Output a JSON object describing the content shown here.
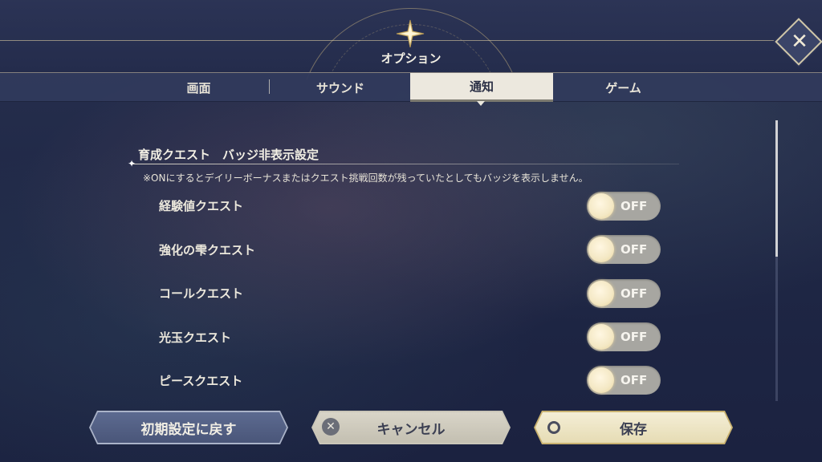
{
  "header": {
    "title": "オプション",
    "close_icon": "close-icon"
  },
  "tabs": [
    {
      "label": "画面",
      "active": false
    },
    {
      "label": "サウンド",
      "active": false
    },
    {
      "label": "通知",
      "active": true
    },
    {
      "label": "ゲーム",
      "active": false
    }
  ],
  "section": {
    "title": "育成クエスト　バッジ非表示設定",
    "note": "※ONにするとデイリーボーナスまたはクエスト挑戦回数が残っていたとしてもバッジを表示しません。"
  },
  "rows": [
    {
      "label": "経験値クエスト",
      "toggle": "OFF"
    },
    {
      "label": "強化の雫クエスト",
      "toggle": "OFF"
    },
    {
      "label": "コールクエスト",
      "toggle": "OFF"
    },
    {
      "label": "光玉クエスト",
      "toggle": "OFF"
    },
    {
      "label": "ピースクエスト",
      "toggle": "OFF"
    }
  ],
  "footer": {
    "reset_label": "初期設定に戻す",
    "cancel_label": "キャンセル",
    "cancel_icon_glyph": "✕",
    "save_label": "保存"
  },
  "colors": {
    "background": "#1f2748",
    "accent_gold": "#c9b270",
    "active_tab": "#ece8de"
  }
}
